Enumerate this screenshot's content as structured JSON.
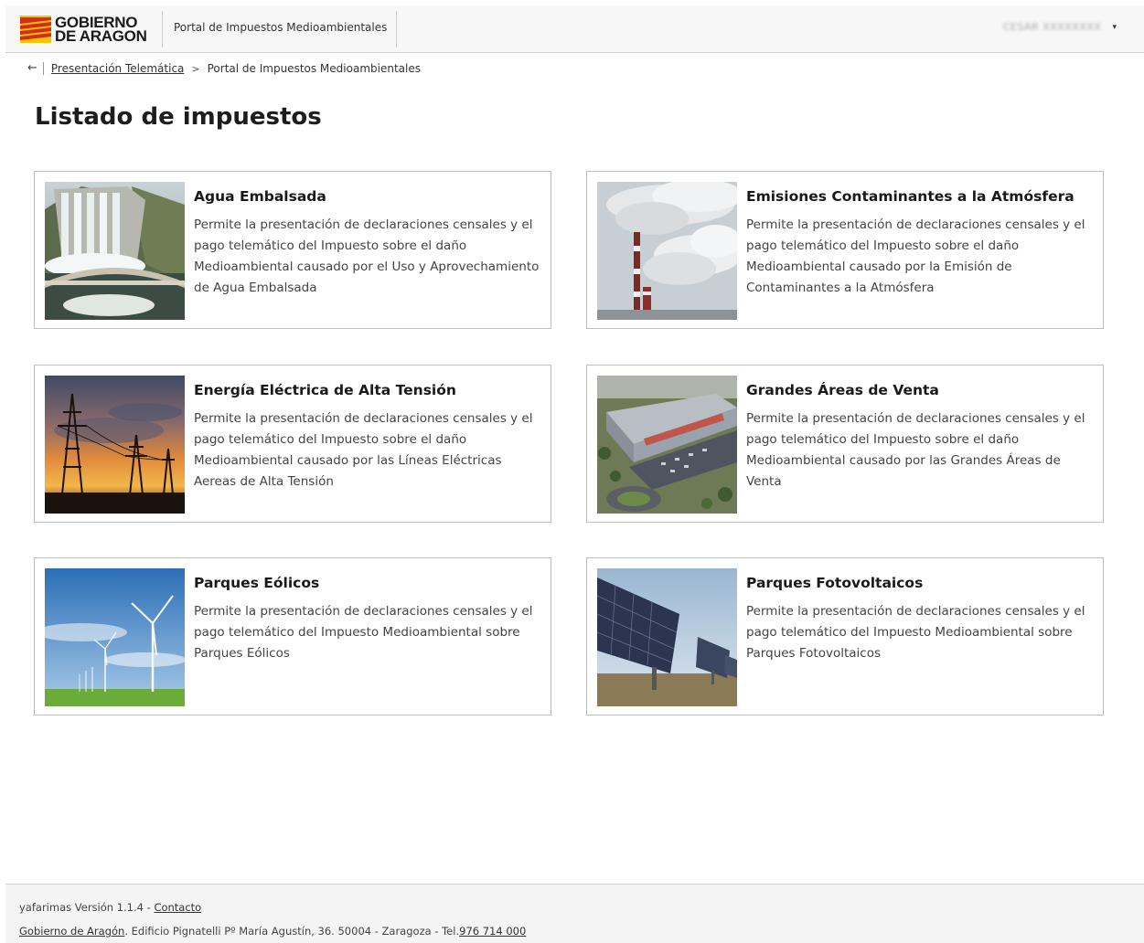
{
  "header": {
    "logo_line1": "GOBIERNO",
    "logo_line2": "DE ARAGON",
    "portal_title": "Portal de Impuestos Medioambientales",
    "user_name": "CESAR XXXXXXXX",
    "dropdown_icon": "caret-down-icon"
  },
  "breadcrumb": {
    "back_icon": "back-arrow-icon",
    "items": [
      "Presentación Telemática",
      "Portal de Impuestos Medioambientales"
    ],
    "separator": ">"
  },
  "page_title": "Listado de impuestos",
  "cards": [
    {
      "title": "Agua Embalsada",
      "description": "Permite la presentación de declaraciones censales y el pago telemático del Impuesto sobre el daño Medioambiental causado por el Uso y Aprovechamiento de Agua Embalsada",
      "image": "dam-photo"
    },
    {
      "title": "Emisiones Contaminantes a la Atmósfera",
      "description": "Permite la presentación de declaraciones censales y el pago telemático del Impuesto sobre el daño Medioambiental causado por la Emisión de Contaminantes a la Atmósfera",
      "image": "smokestack-photo"
    },
    {
      "title": "Energía Eléctrica de Alta Tensión",
      "description": "Permite la presentación de declaraciones censales y el pago telemático del Impuesto sobre el daño Medioambiental causado por las Líneas Eléctricas Aereas de Alta Tensión",
      "image": "power-lines-photo"
    },
    {
      "title": "Grandes Áreas de Venta",
      "description": "Permite la presentación de declaraciones censales y el pago telemático del Impuesto sobre el daño Medioambiental causado por las Grandes Áreas de Venta",
      "image": "shopping-center-photo"
    },
    {
      "title": "Parques Eólicos",
      "description": "Permite la presentación de declaraciones censales y el pago telemático del Impuesto Medioambiental sobre Parques Eólicos",
      "image": "wind-turbines-photo"
    },
    {
      "title": "Parques Fotovoltaicos",
      "description": "Permite la presentación de declaraciones censales y el pago telemático del Impuesto Medioambiental sobre Parques Fotovoltaicos",
      "image": "solar-panels-photo"
    }
  ],
  "footer": {
    "version_text": "yafarimas Versión 1.1.4 - ",
    "contact_link": "Contacto",
    "gov_link": "Gobierno de Aragón",
    "address_text": ". Edificio Pignatelli Pº María Agustín, 36. 50004 - Zaragoza - Tel.",
    "phone_link": "976 714 000"
  },
  "colors": {
    "logo_red": "#d52b1e",
    "logo_yellow": "#f6c500",
    "header_bg": "#f7f7f7",
    "card_border": "#bdbdbd"
  }
}
